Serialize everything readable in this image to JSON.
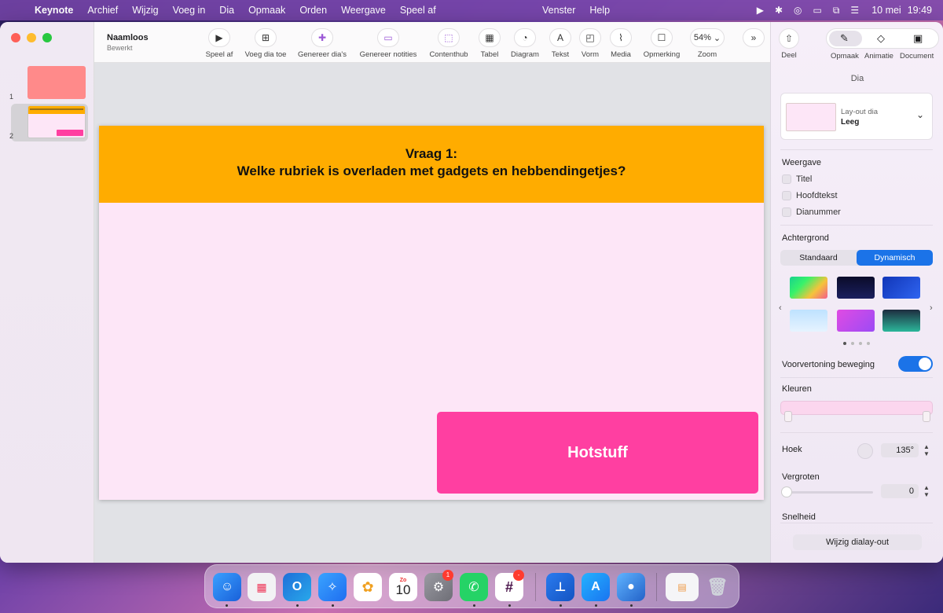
{
  "menubar": {
    "app": "Keynote",
    "items": [
      "Archief",
      "Wijzig",
      "Voeg in",
      "Dia",
      "Opmaak",
      "Orden",
      "Weergave",
      "Speel af"
    ],
    "center_items": [
      "Venster",
      "Help"
    ],
    "date": "10 mei",
    "time": "19:49"
  },
  "document": {
    "title": "Naamloos",
    "subtitle": "Bewerkt"
  },
  "navigator": {
    "slides": [
      {
        "number": "1"
      },
      {
        "number": "2"
      }
    ]
  },
  "toolbar": {
    "play": "Speel af",
    "add_slide": "Voeg dia toe",
    "gen_slides": "Genereer dia's",
    "gen_notes": "Genereer notities",
    "contenthub": "Contenthub",
    "table": "Tabel",
    "chart": "Diagram",
    "text": "Tekst",
    "shape": "Vorm",
    "media": "Media",
    "comment": "Opmerking",
    "zoom_value": "54%",
    "zoom": "Zoom"
  },
  "slide": {
    "question_number": "Vraag 1:",
    "question": "Welke rubriek is overladen met gadgets en hebbendingetjes?",
    "answer_button": "Hotstuff"
  },
  "inspector": {
    "share": "Deel",
    "tab_format": "Opmaak",
    "tab_animate": "Animatie",
    "tab_document": "Document",
    "heading": "Dia",
    "layout_label": "Lay-out dia",
    "layout_value": "Leeg",
    "appearance": "Weergave",
    "chk_title": "Titel",
    "chk_body": "Hoofdtekst",
    "chk_number": "Dianummer",
    "background": "Achtergrond",
    "bg_standard": "Standaard",
    "bg_dynamic": "Dynamisch",
    "preview_motion": "Voorvertoning beweging",
    "colors": "Kleuren",
    "angle_label": "Hoek",
    "angle_value": "135°",
    "scale_label": "Vergroten",
    "scale_value": "0",
    "speed_label": "Snelheid",
    "edit_layout": "Wijzig dialay-out"
  },
  "dock": {
    "calendar_month": "Zo",
    "calendar_day": "10",
    "settings_badge": "1",
    "slack_badge": "-"
  },
  "colors": {
    "accent": "#1b73e8",
    "slide_header": "#ffac00",
    "slide_bg": "#fde6f7",
    "answer_pink": "#ff3fa1"
  }
}
